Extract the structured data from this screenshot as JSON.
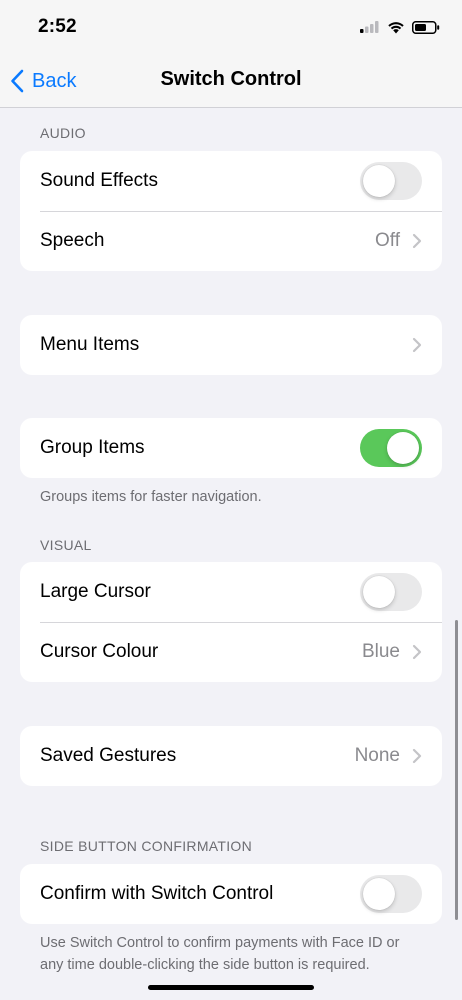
{
  "status_bar": {
    "time": "2:52",
    "icons": [
      "signal-icon",
      "wifi-icon",
      "battery-icon"
    ]
  },
  "nav": {
    "back_label": "Back",
    "title": "Switch Control"
  },
  "audio": {
    "header": "AUDIO",
    "sound_effects": {
      "label": "Sound Effects",
      "on": false
    },
    "speech": {
      "label": "Speech",
      "value": "Off"
    }
  },
  "menu_items": {
    "label": "Menu Items"
  },
  "group_items": {
    "label": "Group Items",
    "on": true,
    "footer": "Groups items for faster navigation."
  },
  "visual": {
    "header": "VISUAL",
    "large_cursor": {
      "label": "Large Cursor",
      "on": false
    },
    "cursor_colour": {
      "label": "Cursor Colour",
      "value": "Blue"
    }
  },
  "saved_gestures": {
    "label": "Saved Gestures",
    "value": "None"
  },
  "side_button": {
    "header": "SIDE BUTTON CONFIRMATION",
    "confirm": {
      "label": "Confirm with Switch Control",
      "on": false
    },
    "footer": "Use Switch Control to confirm payments with Face ID or any time double-clicking the side button is required."
  },
  "colors": {
    "accent": "#0a7aff",
    "toggle_on": "#5ac85a",
    "toggle_off": "#e9e9ea",
    "background": "#f2f2f7"
  }
}
